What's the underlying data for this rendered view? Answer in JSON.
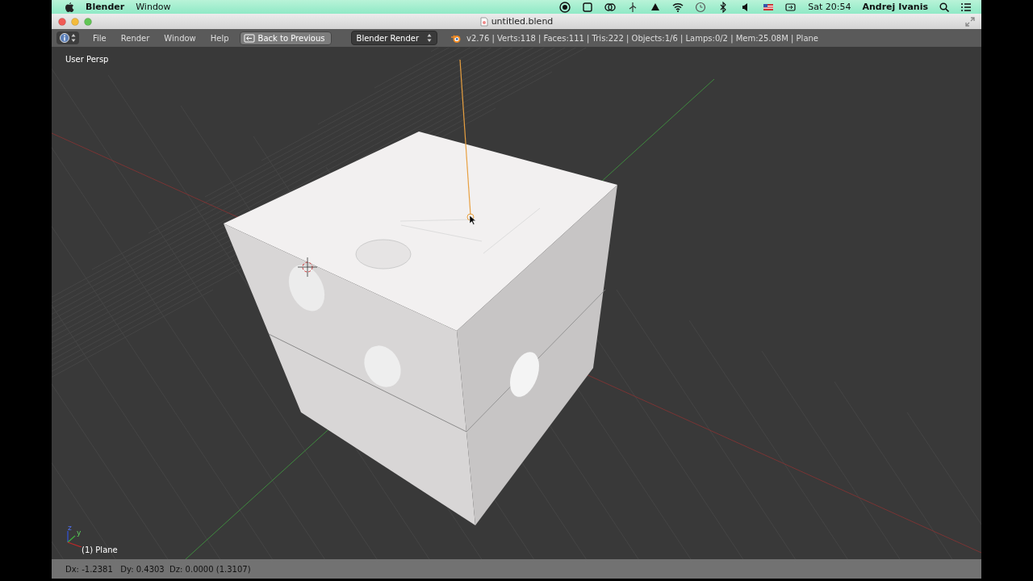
{
  "menubar": {
    "app": "Blender",
    "menus": [
      "Window"
    ],
    "clock": "Sat 20:54",
    "user": "Andrej Ivanis"
  },
  "window": {
    "title": "untitled.blend"
  },
  "header": {
    "menus": [
      "File",
      "Render",
      "Window",
      "Help"
    ],
    "back_button": "Back to Previous",
    "engine": "Blender Render",
    "stats": "v2.76 | Verts:118 | Faces:111 | Tris:222 | Objects:1/6 | Lamps:0/2 | Mem:25.08M | Plane"
  },
  "viewport": {
    "view_label": "User Persp",
    "object_label": "(1) Plane",
    "axis_labels": [
      "z",
      "y"
    ]
  },
  "status_bar": {
    "text": "Dx: -1.2381   Dy: 0.4303  Dz: 0.0000 (1.3107)"
  }
}
